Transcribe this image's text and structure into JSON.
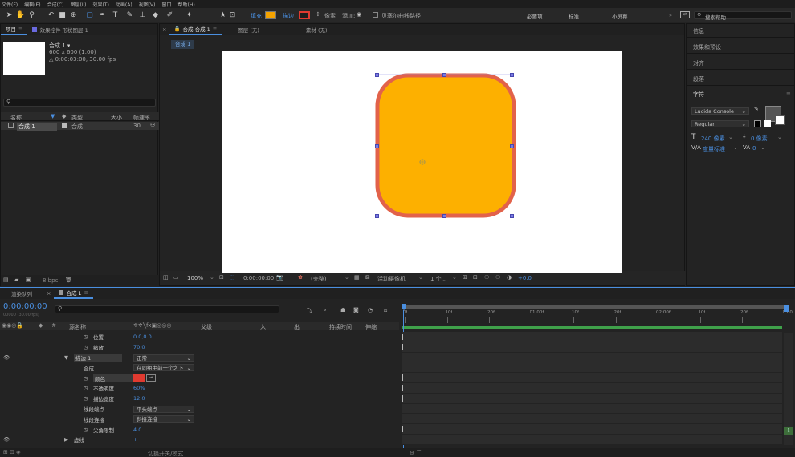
{
  "menu": [
    "文件(F)",
    "编辑(E)",
    "合成(C)",
    "图层(L)",
    "效果(T)",
    "动画(A)",
    "视图(V)",
    "窗口",
    "帮助(H)"
  ],
  "toolbar": {
    "fill_label": "填充",
    "stroke_label": "描边",
    "stroke_width": "像素",
    "add_label": "添加:",
    "bezier_label": "贝塞尔曲线路径",
    "workspaces": [
      "必要项",
      "标准",
      "小屏幕"
    ],
    "search_placeholder": "搜索帮助",
    "fill_color": "#f5a300",
    "stroke_color": "#e03a30"
  },
  "project_panel": {
    "tab_label": "项目",
    "effect_controls_tab": "效果控件 形状图层 1",
    "comp_name": "合成 1 ▾",
    "comp_size": "600 x 600 (1.00)",
    "comp_duration": "△ 0:00:03:00, 30.00 fps",
    "columns": [
      "名称",
      "类型",
      "大小",
      "帧速率"
    ],
    "items": [
      {
        "name": "合成 1",
        "type": "合成",
        "fps": "30"
      }
    ],
    "bpc": "8 bpc"
  },
  "viewer": {
    "tabs": [
      "合成 合成 1",
      "图层 (无)",
      "素材 (无)"
    ],
    "breadcrumb": "合成 1",
    "zoom": "100%",
    "timecode": "0:00:00:00",
    "resolution": "(完整)",
    "camera": "活动摄像机",
    "views": "1 个...",
    "exposure": "+0.0"
  },
  "right_panel": {
    "sections": [
      "信息",
      "效果和预设",
      "对齐",
      "段落",
      "字符"
    ],
    "font": "Lucida Console",
    "style": "Regular",
    "size": "240 像素",
    "leading": "0 像素",
    "kerning": "度量标准",
    "tracking": "0"
  },
  "timeline": {
    "tabs": [
      "渲染队列",
      "合成 1"
    ],
    "timecode": "0:00:00:00",
    "timecode_sub": "00000 (30.00 fps)",
    "headers": [
      "源名称",
      "父级",
      "入",
      "出",
      "持续时间",
      "伸缩"
    ],
    "properties": [
      {
        "label": "位置",
        "value": "0.0,0.0",
        "indent": 1,
        "stopwatch": true
      },
      {
        "label": "缩放",
        "value": "70.0",
        "indent": 1,
        "stopwatch": true
      },
      {
        "label": "描边 1",
        "value": "正常",
        "indent": 0,
        "expand": "▼",
        "dropdown": true,
        "highlight": true
      },
      {
        "label": "合成",
        "value": "在同组中前一个之下",
        "indent": 1,
        "dropdown": true
      },
      {
        "label": "颜色",
        "value": "",
        "indent": 1,
        "stopwatch": true,
        "color": true,
        "highlight": true
      },
      {
        "label": "不透明度",
        "value": "60%",
        "indent": 1,
        "stopwatch": true
      },
      {
        "label": "描边宽度",
        "value": "12.0",
        "indent": 1,
        "stopwatch": true
      },
      {
        "label": "线段端点",
        "value": "平头端点",
        "indent": 1,
        "dropdown": true
      },
      {
        "label": "线段连接",
        "value": "斜接连接",
        "indent": 1,
        "dropdown": true
      },
      {
        "label": "尖角限制",
        "value": "4.0",
        "indent": 1,
        "stopwatch": true
      },
      {
        "label": "虚线",
        "value": "+",
        "indent": 0,
        "expand": "▶"
      }
    ],
    "ruler": [
      "0f",
      "10f",
      "20f",
      "01:00f",
      "10f",
      "20f",
      "02:00f",
      "10f",
      "20f",
      "03:0"
    ],
    "footer": "切换开关/模式"
  },
  "shape": {
    "fill": "#fdb000",
    "stroke": "#e2624a"
  }
}
